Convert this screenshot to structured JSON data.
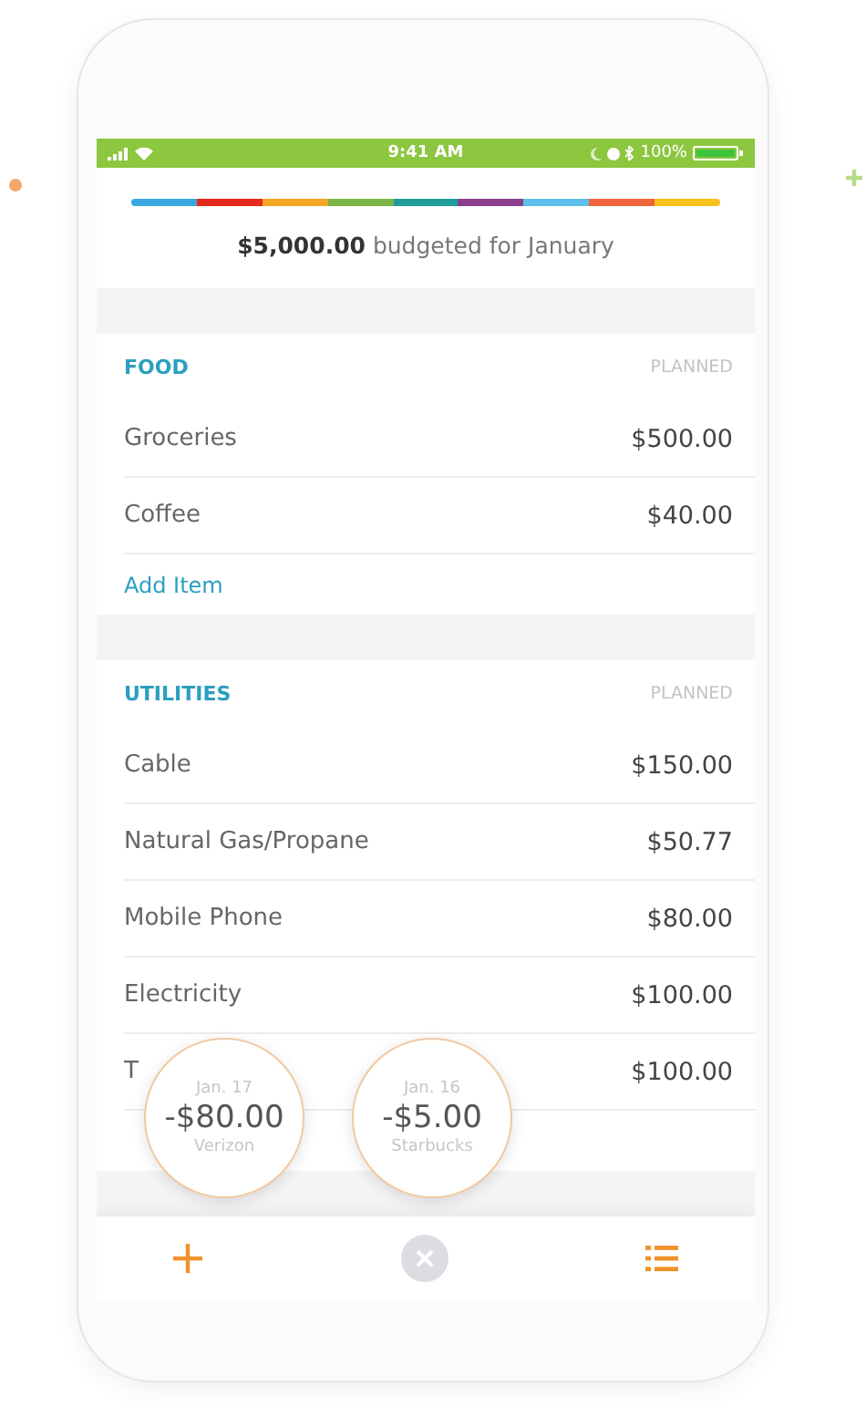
{
  "status_bar": {
    "time": "9:41 AM",
    "battery": "100%"
  },
  "budget": {
    "segments": [
      {
        "color": "#3aa8e0"
      },
      {
        "color": "#e52a1d"
      },
      {
        "color": "#f5a623"
      },
      {
        "color": "#7ab648"
      },
      {
        "color": "#1f9e9a"
      },
      {
        "color": "#8a3f8c"
      },
      {
        "color": "#5bc0eb"
      },
      {
        "color": "#f0643c"
      },
      {
        "color": "#f6c11c"
      }
    ],
    "amount": "$5,000.00",
    "caption": "budgeted for January"
  },
  "sections": [
    {
      "title": "FOOD",
      "column": "PLANNED",
      "items": [
        {
          "label": "Groceries",
          "value": "$500.00"
        },
        {
          "label": "Coffee",
          "value": "$40.00"
        }
      ],
      "add_item": "Add Item"
    },
    {
      "title": "UTILITIES",
      "column": "PLANNED",
      "items": [
        {
          "label": "Cable",
          "value": "$150.00"
        },
        {
          "label": "Natural Gas/Propane",
          "value": "$50.77"
        },
        {
          "label": "Mobile Phone",
          "value": "$80.00"
        },
        {
          "label": "Electricity",
          "value": "$100.00"
        },
        {
          "label": "T",
          "value": "$100.00"
        }
      ]
    }
  ],
  "transactions": [
    {
      "date": "Jan. 17",
      "amount": "-$80.00",
      "merchant": "Verizon"
    },
    {
      "date": "Jan. 16",
      "amount": "-$5.00",
      "merchant": "Starbucks"
    }
  ]
}
